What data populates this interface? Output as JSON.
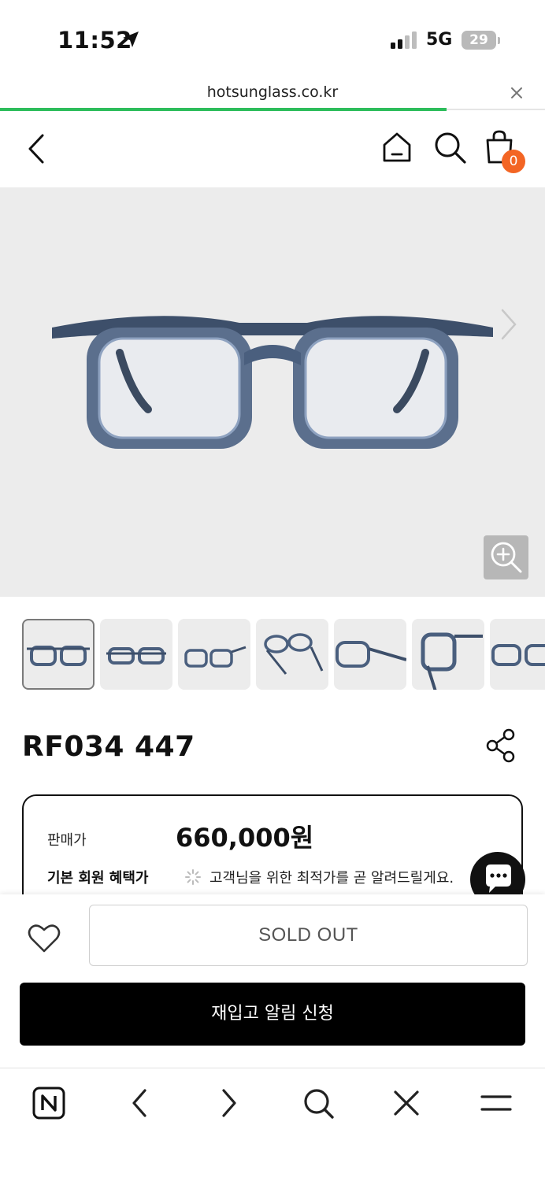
{
  "status_bar": {
    "time": "11:52",
    "network": "5G",
    "battery": "29"
  },
  "browser": {
    "url": "hotsunglass.co.kr",
    "load_progress": 0.82
  },
  "header": {
    "cart_count": "0"
  },
  "product": {
    "name": "RF034 447",
    "thumbnail_count": 7
  },
  "price": {
    "sale_label": "판매가",
    "sale_price": "660,000원",
    "member_label": "기본 회원 혜택가",
    "member_message": "고객님을 위한 최적가를 곧 알려드릴게요."
  },
  "actions": {
    "sold_out_label": "SOLD OUT",
    "restock_label": "재입고 알림 신청"
  },
  "colors": {
    "accent_green": "#2dbd5b",
    "badge_orange": "#f36524",
    "frame_blue": "#4a5f7e"
  }
}
